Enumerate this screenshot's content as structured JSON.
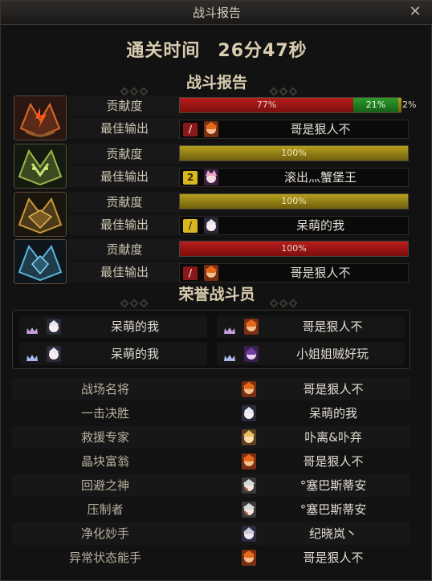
{
  "window": {
    "title": "战斗报告",
    "close_label": "✕"
  },
  "clear_time": {
    "label": "通关时间",
    "value": "26分47秒"
  },
  "sections": {
    "report": "战斗报告",
    "honor": "荣誉战斗员"
  },
  "bosses": [
    {
      "icon": "red-horned-boss-icon",
      "contribution_label": "贡献度",
      "best_label": "最佳输出",
      "segments": [
        {
          "label": "77%",
          "value": 77,
          "color": "#b71c1c"
        },
        {
          "label": "21%",
          "value": 21,
          "color": "#2c9a2c"
        },
        {
          "label": "2%",
          "value": 2,
          "color": "#d6b621"
        }
      ],
      "best_class": "red-slash-icon",
      "best_name": "哥是狠人不"
    },
    {
      "icon": "green-horned-boss-icon",
      "contribution_label": "贡献度",
      "best_label": "最佳输出",
      "segments": [
        {
          "label": "100%",
          "value": 100,
          "color": "#b59e1d"
        }
      ],
      "best_class_text": "2",
      "best_name": "滚出灬蟹堡王"
    },
    {
      "icon": "gold-horned-boss-icon",
      "contribution_label": "贡献度",
      "best_label": "最佳输出",
      "segments": [
        {
          "label": "100%",
          "value": 100,
          "color": "#b59e1d"
        }
      ],
      "best_class": "yellow-slash-icon",
      "best_name": "呆萌的我"
    },
    {
      "icon": "blue-horned-boss-icon",
      "contribution_label": "贡献度",
      "best_label": "最佳输出",
      "segments": [
        {
          "label": "100%",
          "value": 100,
          "color": "#b71c1c"
        }
      ],
      "best_class": "red-slash-icon",
      "best_name": "哥是狠人不"
    }
  ],
  "honor_members": [
    {
      "name": "呆萌的我"
    },
    {
      "name": "哥是狠人不"
    },
    {
      "name": "呆萌的我"
    },
    {
      "name": "小姐姐贼好玩"
    }
  ],
  "awards": [
    {
      "title": "战场名将",
      "name": "哥是狠人不"
    },
    {
      "title": "一击决胜",
      "name": "呆萌的我"
    },
    {
      "title": "救援专家",
      "name": "卟离&卟弃"
    },
    {
      "title": "晶块富翁",
      "name": "哥是狠人不"
    },
    {
      "title": "回避之神",
      "name": "°塞巴斯蒂安"
    },
    {
      "title": "压制者",
      "name": "°塞巴斯蒂安"
    },
    {
      "title": "净化妙手",
      "name": "纪晓岚丶"
    },
    {
      "title": "异常状态能手",
      "name": "哥是狠人不"
    }
  ],
  "colors": {
    "accent_gold": "#d9ccb0",
    "bar_red": "#b71c1c",
    "bar_green": "#2c9a2c",
    "bar_yellow": "#b59e1d"
  }
}
